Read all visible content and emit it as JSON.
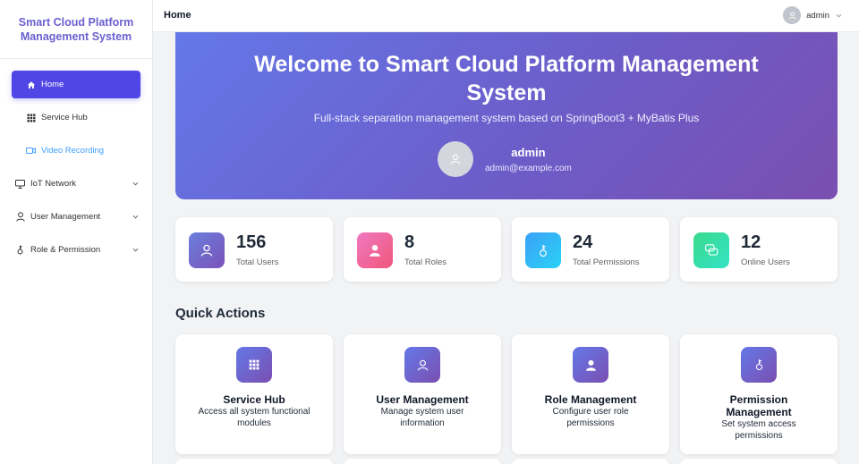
{
  "app": {
    "title_line1": "Smart Cloud Platform",
    "title_line2": "Management System"
  },
  "sidebar": {
    "items": [
      {
        "label": "Home",
        "icon": "home-icon"
      },
      {
        "label": "Service Hub",
        "icon": "grid-icon"
      },
      {
        "label": "Video Recording",
        "icon": "video-icon"
      },
      {
        "label": "IoT Network",
        "icon": "monitor-icon"
      },
      {
        "label": "User Management",
        "icon": "user-icon"
      },
      {
        "label": "Role & Permission",
        "icon": "key-icon"
      }
    ]
  },
  "header": {
    "title": "Home",
    "user": "admin"
  },
  "banner": {
    "title": "Welcome to Smart Cloud Platform Management System",
    "subtitle": "Full-stack separation management system based on SpringBoot3 + MyBatis Plus",
    "username": "admin",
    "email": "admin@example.com"
  },
  "stats": [
    {
      "value": "156",
      "label": "Total Users",
      "color_from": "#6a7fdc",
      "color_to": "#7b52b8"
    },
    {
      "value": "8",
      "label": "Total Roles",
      "color_from": "#f07ac0",
      "color_to": "#f0567a"
    },
    {
      "value": "24",
      "label": "Total Permissions",
      "color_from": "#3aa0f8",
      "color_to": "#2ad2f5"
    },
    {
      "value": "12",
      "label": "Online Users",
      "color_from": "#3ad98c",
      "color_to": "#34e3c6"
    }
  ],
  "quick_actions": {
    "title": "Quick Actions",
    "items": [
      {
        "title": "Service Hub",
        "desc": "Access all system functional modules",
        "icon": "grid-icon"
      },
      {
        "title": "User Management",
        "desc": "Manage system user information",
        "icon": "user-icon"
      },
      {
        "title": "Role Management",
        "desc": "Configure user role permissions",
        "icon": "person-filled-icon"
      },
      {
        "title": "Permission Management",
        "desc": "Set system access permissions",
        "icon": "key-icon"
      }
    ]
  },
  "colors": {
    "accent": "#4f46e5",
    "brand_text": "#6b5fcf",
    "link": "#409eff"
  }
}
